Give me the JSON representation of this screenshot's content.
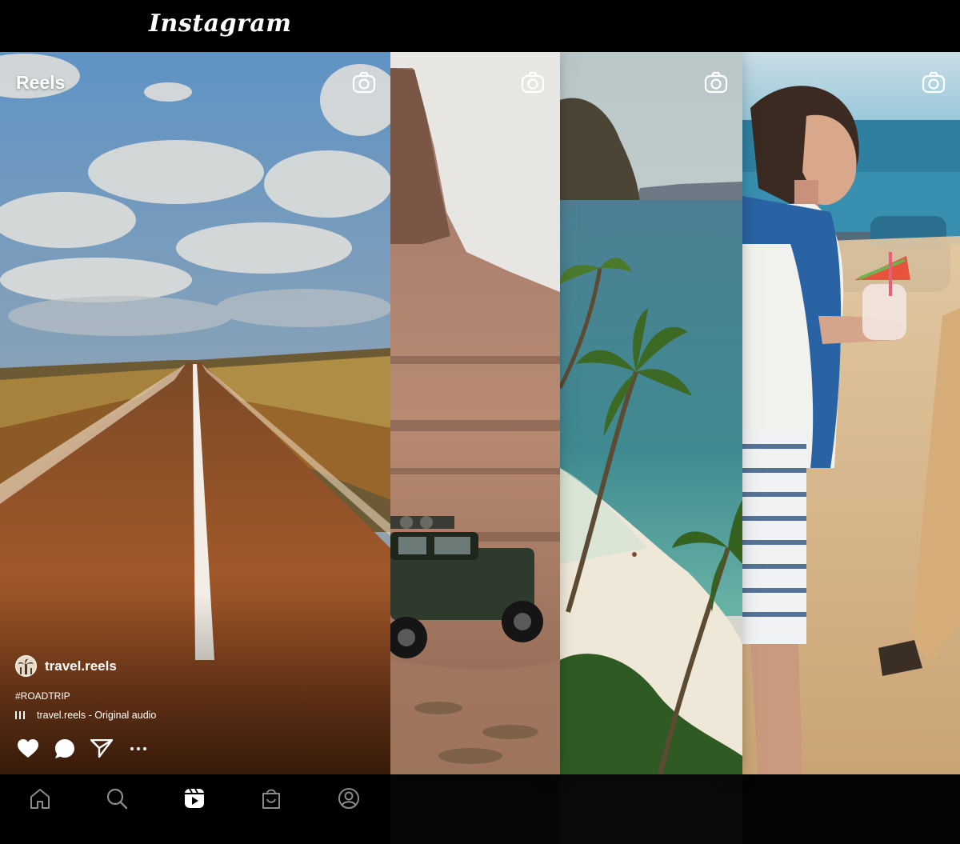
{
  "app": {
    "brand": "Instagram"
  },
  "header": {
    "title": "Reels"
  },
  "reel": {
    "username": "travel.reels",
    "hashtag": "#ROADTRIP",
    "audio": "travel.reels - Original audio"
  },
  "icons": {
    "camera": "camera-icon",
    "like": "heart-icon",
    "comment": "comment-icon",
    "share": "send-icon",
    "more": "more-icon"
  },
  "nav": [
    {
      "name": "home",
      "icon": "home-icon"
    },
    {
      "name": "search",
      "icon": "search-icon"
    },
    {
      "name": "reels",
      "icon": "reels-icon",
      "active": true
    },
    {
      "name": "shop",
      "icon": "shop-icon"
    },
    {
      "name": "profile",
      "icon": "profile-icon"
    }
  ],
  "colors": {
    "background": "#000000",
    "text": "#ffffff"
  }
}
